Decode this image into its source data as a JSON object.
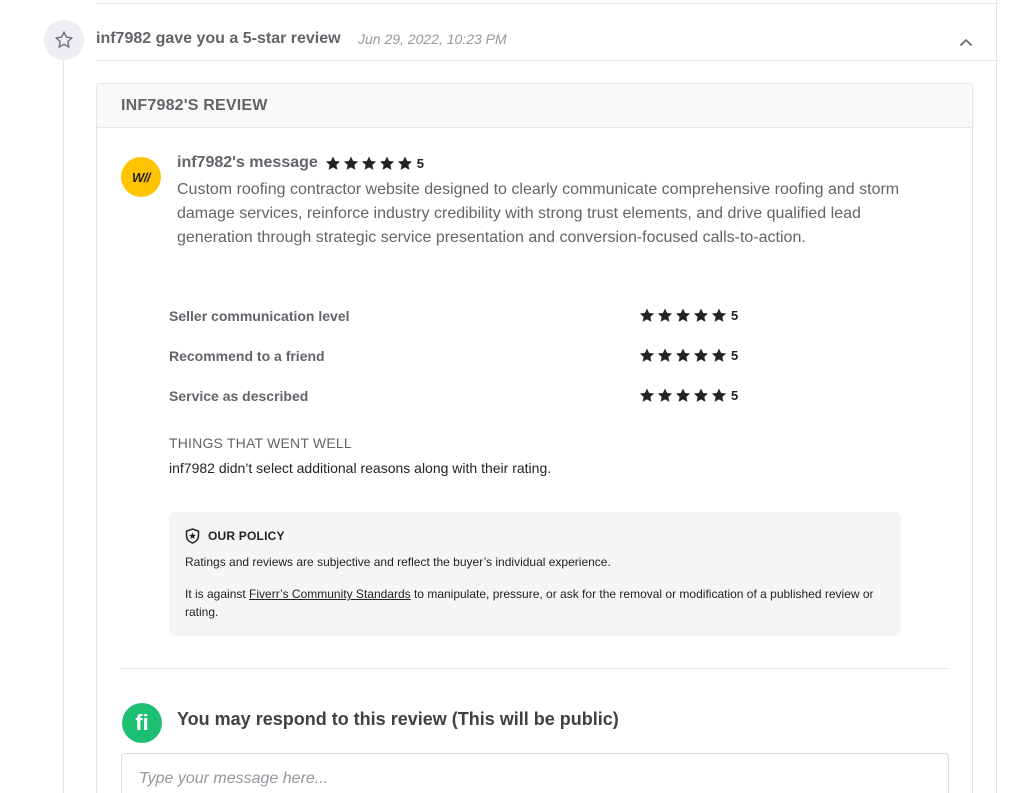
{
  "event": {
    "title": "inf7982 gave you a 5-star review",
    "date": "Jun 29, 2022, 10:23 PM",
    "badge_icon": "star-outline-icon",
    "collapse_icon": "chevron-up-icon"
  },
  "review": {
    "header": "INF7982'S REVIEW",
    "avatar_text": "W//",
    "avatar_color": "#ffc300",
    "author_label": "inf7982's message",
    "overall_rating": "5",
    "overall_rating_value": 5,
    "message": "Custom roofing contractor website designed to clearly communicate comprehensive roofing and storm damage services, reinforce industry credibility with strong trust elements, and drive qualified lead generation through strategic service presentation and conversion-focused calls-to-action.",
    "criteria": [
      {
        "label": "Seller communication level",
        "rating": "5",
        "rating_value": 5
      },
      {
        "label": "Recommend to a friend",
        "rating": "5",
        "rating_value": 5
      },
      {
        "label": "Service as described",
        "rating": "5",
        "rating_value": 5
      }
    ],
    "went_well_title": "THINGS THAT WENT WELL",
    "went_well_text": "inf7982 didn’t select additional reasons along with their rating."
  },
  "policy": {
    "title": "OUR POLICY",
    "icon": "shield-star-icon",
    "text1": "Ratings and reviews are subjective and reflect the buyer’s individual experience.",
    "text2_before": "It is against ",
    "link_text": "Fiverr’s Community Standards",
    "text2_after": " to manipulate, pressure, or ask for the removal or modification of a published review or rating."
  },
  "respond": {
    "logo_text": "fi",
    "logo_color": "#1dbf73",
    "title": "You may respond to this review (This will be public)",
    "placeholder": "Type your message here..."
  },
  "colors": {
    "star": "#222325",
    "muted_text": "#62646a",
    "border": "#e4e5e7"
  }
}
